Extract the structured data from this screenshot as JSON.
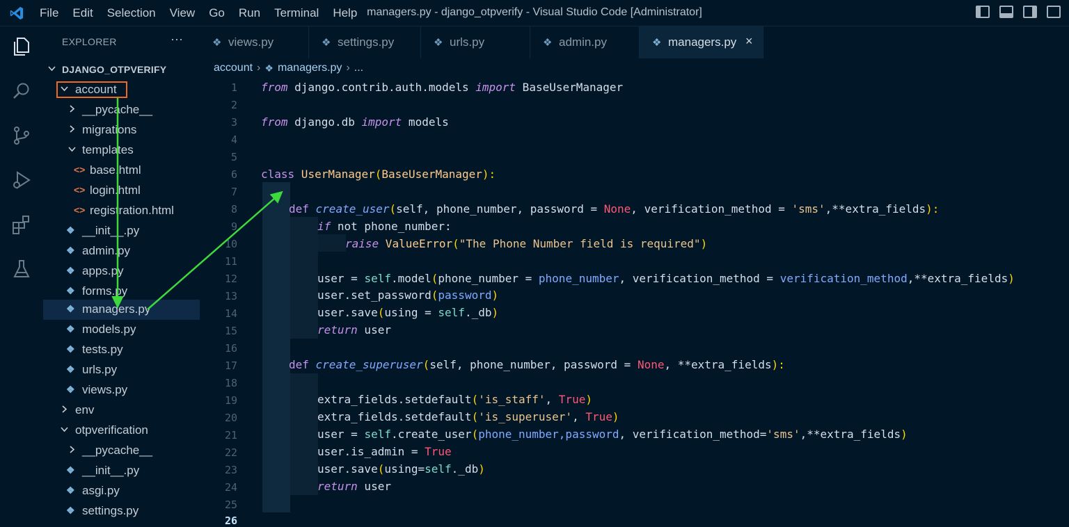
{
  "menu": [
    "File",
    "Edit",
    "Selection",
    "View",
    "Go",
    "Run",
    "Terminal",
    "Help"
  ],
  "window_title": "managers.py - django_otpverify - Visual Studio Code [Administrator]",
  "explorer": {
    "header": "EXPLORER",
    "more": "···",
    "root": "DJANGO_OTPVERIFY",
    "items": [
      {
        "label": "account",
        "kind": "folder-open"
      },
      {
        "label": "__pycache__",
        "kind": "folder"
      },
      {
        "label": "migrations",
        "kind": "folder"
      },
      {
        "label": "templates",
        "kind": "folder-open"
      },
      {
        "label": "base.html",
        "kind": "html"
      },
      {
        "label": "login.html",
        "kind": "html"
      },
      {
        "label": "registration.html",
        "kind": "html"
      },
      {
        "label": "__init__.py",
        "kind": "py"
      },
      {
        "label": "admin.py",
        "kind": "py"
      },
      {
        "label": "apps.py",
        "kind": "py"
      },
      {
        "label": "forms.py",
        "kind": "py"
      },
      {
        "label": "managers.py",
        "kind": "py"
      },
      {
        "label": "models.py",
        "kind": "py"
      },
      {
        "label": "tests.py",
        "kind": "py"
      },
      {
        "label": "urls.py",
        "kind": "py"
      },
      {
        "label": "views.py",
        "kind": "py"
      },
      {
        "label": "env",
        "kind": "folder"
      },
      {
        "label": "otpverification",
        "kind": "folder-open"
      },
      {
        "label": "__pycache__",
        "kind": "folder"
      },
      {
        "label": "__init__.py",
        "kind": "py"
      },
      {
        "label": "asgi.py",
        "kind": "py"
      },
      {
        "label": "settings.py",
        "kind": "py"
      }
    ]
  },
  "tabs": [
    "views.py",
    "settings.py",
    "urls.py",
    "admin.py",
    "managers.py"
  ],
  "tab_close": "×",
  "breadcrumb": {
    "folder": "account",
    "file": "managers.py",
    "more": "..."
  },
  "line_numbers": [
    "1",
    "2",
    "3",
    "4",
    "5",
    "6",
    "7",
    "8",
    "9",
    "10",
    "11",
    "12",
    "13",
    "14",
    "15",
    "16",
    "17",
    "18",
    "19",
    "20",
    "21",
    "22",
    "23",
    "24",
    "25",
    "26"
  ],
  "code": {
    "l1": {
      "from": "from",
      "mod": " django.contrib.auth.models ",
      "imp": "import",
      "name": " BaseUserManager"
    },
    "l3": {
      "from": "from",
      "mod": " django.db ",
      "imp": "import",
      "name": " models"
    },
    "l6": {
      "cls": "class",
      "name": " UserManager",
      "open": "(",
      "base": "BaseUserManager",
      "close": "):"
    },
    "l8": {
      "def": "def",
      "fn": " create_user",
      "p1": "(",
      "args1": "self, phone_number, password = ",
      "none": "None",
      "args2": ", verification_method = ",
      "str": "'sms'",
      "args3": ",**extra_fields",
      "p2": "):"
    },
    "l9": {
      "if": "if",
      "rest": " not phone_number:"
    },
    "l10": {
      "raise": "raise",
      "err": " ValueError",
      "p1": "(",
      "str": "\"The Phone Number field is required\"",
      "p2": ")"
    },
    "l12": {
      "a": "user = ",
      "slf": "self",
      "b": ".model",
      "p1": "(",
      "c": "phone_number = ",
      "v1": "phone_number",
      "d": ", verification_method = ",
      "v2": "verification_method",
      "e": ",**extra_fields",
      "p2": ")"
    },
    "l13": {
      "a": "user.set_password",
      "p1": "(",
      "v": "password",
      "p2": ")"
    },
    "l14": {
      "a": "user.save",
      "p1": "(",
      "b": "using = ",
      "slf": "self",
      "c": "._db",
      "p2": ")"
    },
    "l15": {
      "ret": "return",
      "rest": " user"
    },
    "l17": {
      "def": "def",
      "fn": " create_superuser",
      "p1": "(",
      "args1": "self, phone_number, password = ",
      "none": "None",
      "args2": ", **extra_fields",
      "p2": "):"
    },
    "l19": {
      "a": "extra_fields.setdefault",
      "p1": "(",
      "str": "'is_staff'",
      "b": ", ",
      "t": "True",
      "p2": ")"
    },
    "l20": {
      "a": "extra_fields.setdefault",
      "p1": "(",
      "str": "'is_superuser'",
      "b": ", ",
      "t": "True",
      "p2": ")"
    },
    "l21": {
      "a": "user = ",
      "slf": "self",
      "b": ".create_user",
      "p1": "(",
      "v": "phone_number,password",
      "c": ", verification_method=",
      "str": "'sms'",
      "d": ",**extra_fields",
      "p2": ")"
    },
    "l22": {
      "a": "user.is_admin = ",
      "t": "True"
    },
    "l23": {
      "a": "user.save",
      "p1": "(",
      "b": "using=",
      "slf": "self",
      "c": "._db",
      "p2": ")"
    },
    "l24": {
      "ret": "return",
      "rest": " user"
    }
  },
  "colors": {
    "background": "#011627",
    "annotation_box": "#ef6b22",
    "arrow": "#3dd93d"
  }
}
